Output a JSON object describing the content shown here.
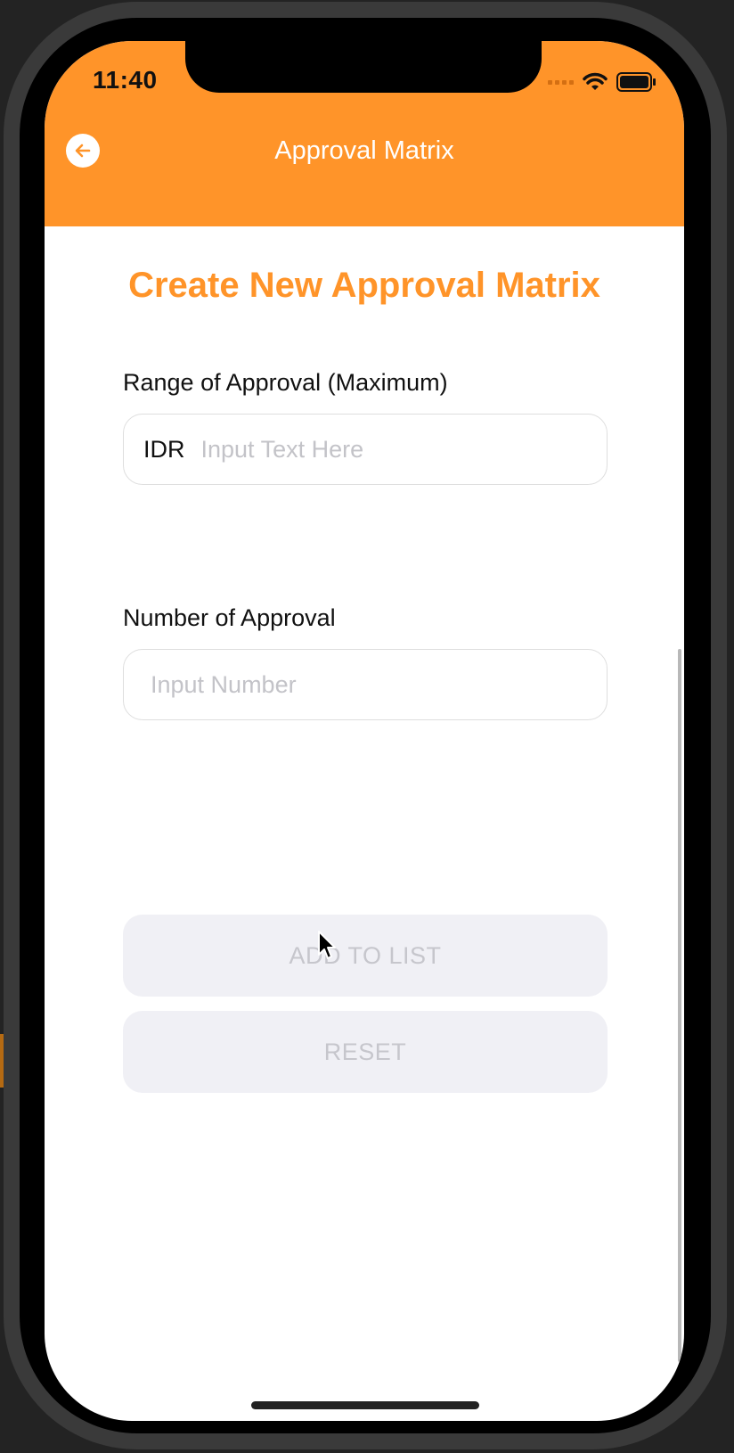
{
  "status_bar": {
    "time": "11:40"
  },
  "nav": {
    "title": "Approval Matrix"
  },
  "form": {
    "heading": "Create New Approval Matrix",
    "range_label": "Range of Approval (Maximum)",
    "range_prefix": "IDR",
    "range_placeholder": "Input Text Here",
    "number_label": "Number of Approval",
    "number_placeholder": "Input Number"
  },
  "actions": {
    "add_label": "ADD TO LIST",
    "reset_label": "RESET"
  },
  "colors": {
    "accent": "#ff9429",
    "button_bg": "#f0f0f5",
    "button_text": "#c6c6cc"
  },
  "icons": {
    "back": "arrow-left-circle-icon",
    "wifi": "wifi-icon",
    "battery": "battery-icon",
    "signal": "cellular-signal-icon"
  }
}
